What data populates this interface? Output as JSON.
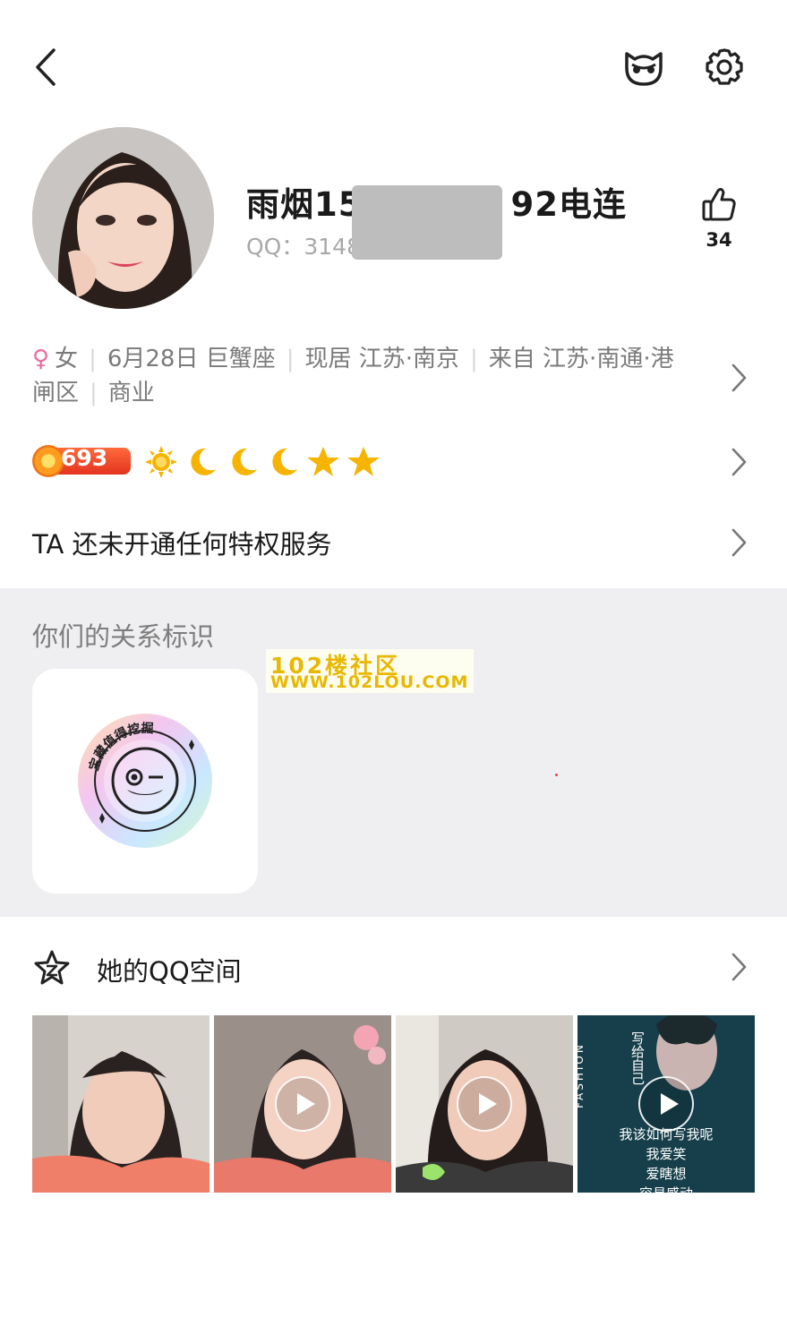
{
  "profile": {
    "nickname": "雨烟15",
    "nickname_tail": "92电连",
    "qq_label": "QQ：3148",
    "likes": "34"
  },
  "info": {
    "gender": "女",
    "birthday": "6月28日 巨蟹座",
    "current_city": "现居 江苏·南京",
    "hometown": "来自 江苏·南通·港闸区",
    "occupation": "商业"
  },
  "level": {
    "vip_value": "693",
    "icons": [
      "sun-icon",
      "moon-icon",
      "moon-icon",
      "moon-icon",
      "star-icon",
      "star-icon"
    ]
  },
  "privilege": {
    "text": "TA 还未开通任何特权服务"
  },
  "relation": {
    "title": "你们的关系标识",
    "badge_text": "宝藏值得挖掘"
  },
  "watermark": {
    "line1": "102楼社区",
    "line2": "WWW.102LOU.COM"
  },
  "qzone": {
    "title": "她的QQ空间",
    "thumbnails": [
      {
        "type": "photo"
      },
      {
        "type": "video"
      },
      {
        "type": "video"
      },
      {
        "type": "video",
        "side_text": "FASHION",
        "title_text": "写给自己",
        "lines": [
          "我该如何写我呢",
          "我爱笑",
          "爱瞎想",
          "容易感动"
        ]
      }
    ]
  },
  "colors": {
    "accent_pink": "#ef6aa0",
    "vip_red": "#e3341f",
    "level_gold": "#f6b400",
    "section_bg": "#efeff1"
  }
}
